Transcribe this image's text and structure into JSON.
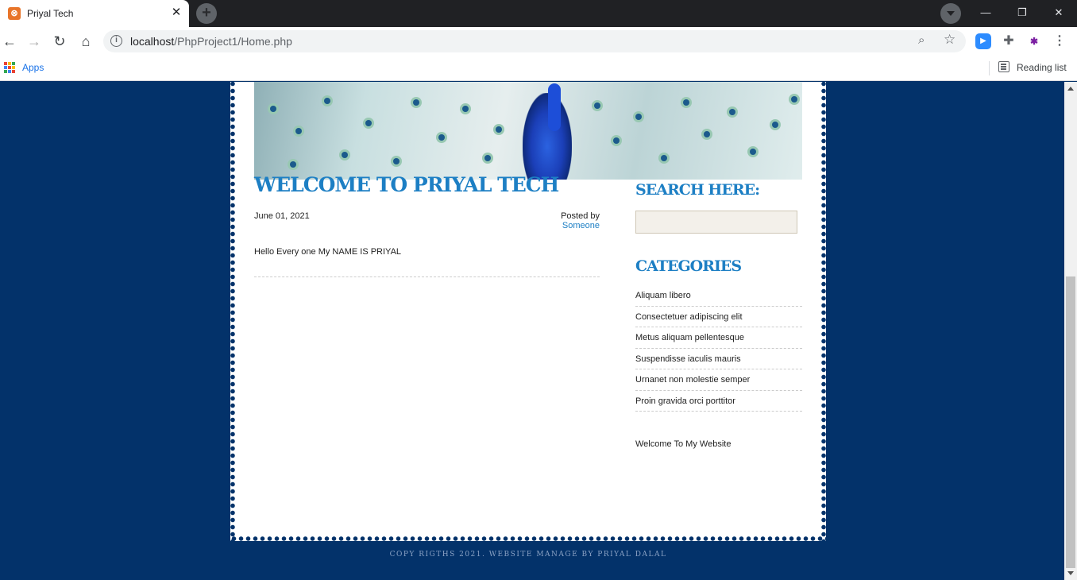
{
  "browser": {
    "tab_title": "Priyal Tech",
    "tab_close": "✕",
    "newtab": "+",
    "url_host": "localhost",
    "url_path": "/PhpProject1/Home.php",
    "bookmarks_apps": "Apps",
    "reading_list": "Reading list"
  },
  "post": {
    "title": "WELCOME TO PRIYAL TECH",
    "date": "June 01, 2021",
    "posted_by_prefix": "Posted by ",
    "author": "Someone",
    "body": "Hello Every one My NAME IS PRIYAL"
  },
  "sidebar": {
    "search_heading": "SEARCH HERE:",
    "categories_heading": "CATEGORIES",
    "categories": [
      "Aliquam libero",
      "Consectetuer adipiscing elit",
      "Metus aliquam pellentesque",
      "Suspendisse iaculis mauris",
      "Urnanet non molestie semper",
      "Proin gravida orci porttitor"
    ],
    "welcome_text": "Welcome To My Website"
  },
  "footer": {
    "copyright": "COPY RIGTHS 2021. WEBSITE MANAGE BY PRIYAL DALAL"
  },
  "colors": {
    "page_bg": "#03326a",
    "accent": "#1d7fc4"
  }
}
